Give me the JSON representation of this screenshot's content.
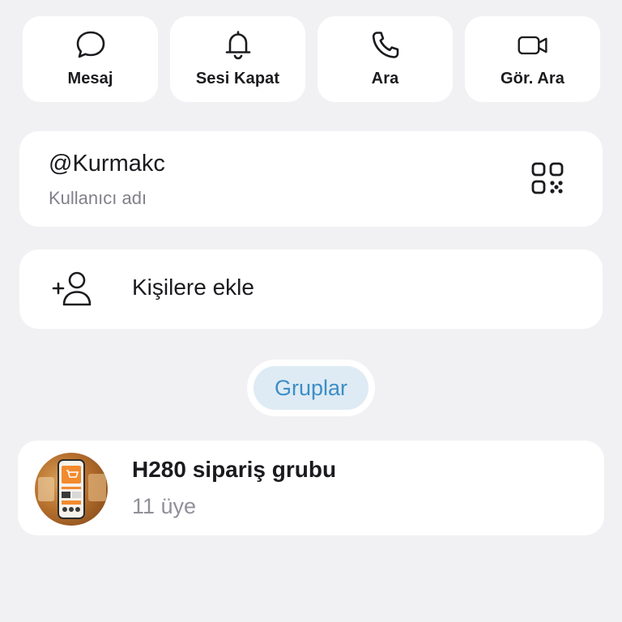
{
  "actions": [
    {
      "id": "message",
      "label": "Mesaj",
      "icon": "chat-bubble-icon"
    },
    {
      "id": "mute",
      "label": "Sesi Kapat",
      "icon": "bell-icon"
    },
    {
      "id": "call",
      "label": "Ara",
      "icon": "phone-icon"
    },
    {
      "id": "video",
      "label": "Gör. Ara",
      "icon": "video-camera-icon"
    }
  ],
  "username": {
    "value": "@Kurmakc",
    "caption": "Kullanıcı adı",
    "qr_icon": "qr-code-icon"
  },
  "add_contact": {
    "label": "Kişilere ekle",
    "icon": "add-person-icon"
  },
  "groups_tab": {
    "label": "Gruplar"
  },
  "groups": [
    {
      "name": "H280 sipariş grubu",
      "members": "11 üye"
    }
  ],
  "colors": {
    "background": "#f1f1f4",
    "card": "#ffffff",
    "accent": "#3d8ec6",
    "accent_bg": "#deebf4",
    "secondary_text": "#80808a"
  }
}
